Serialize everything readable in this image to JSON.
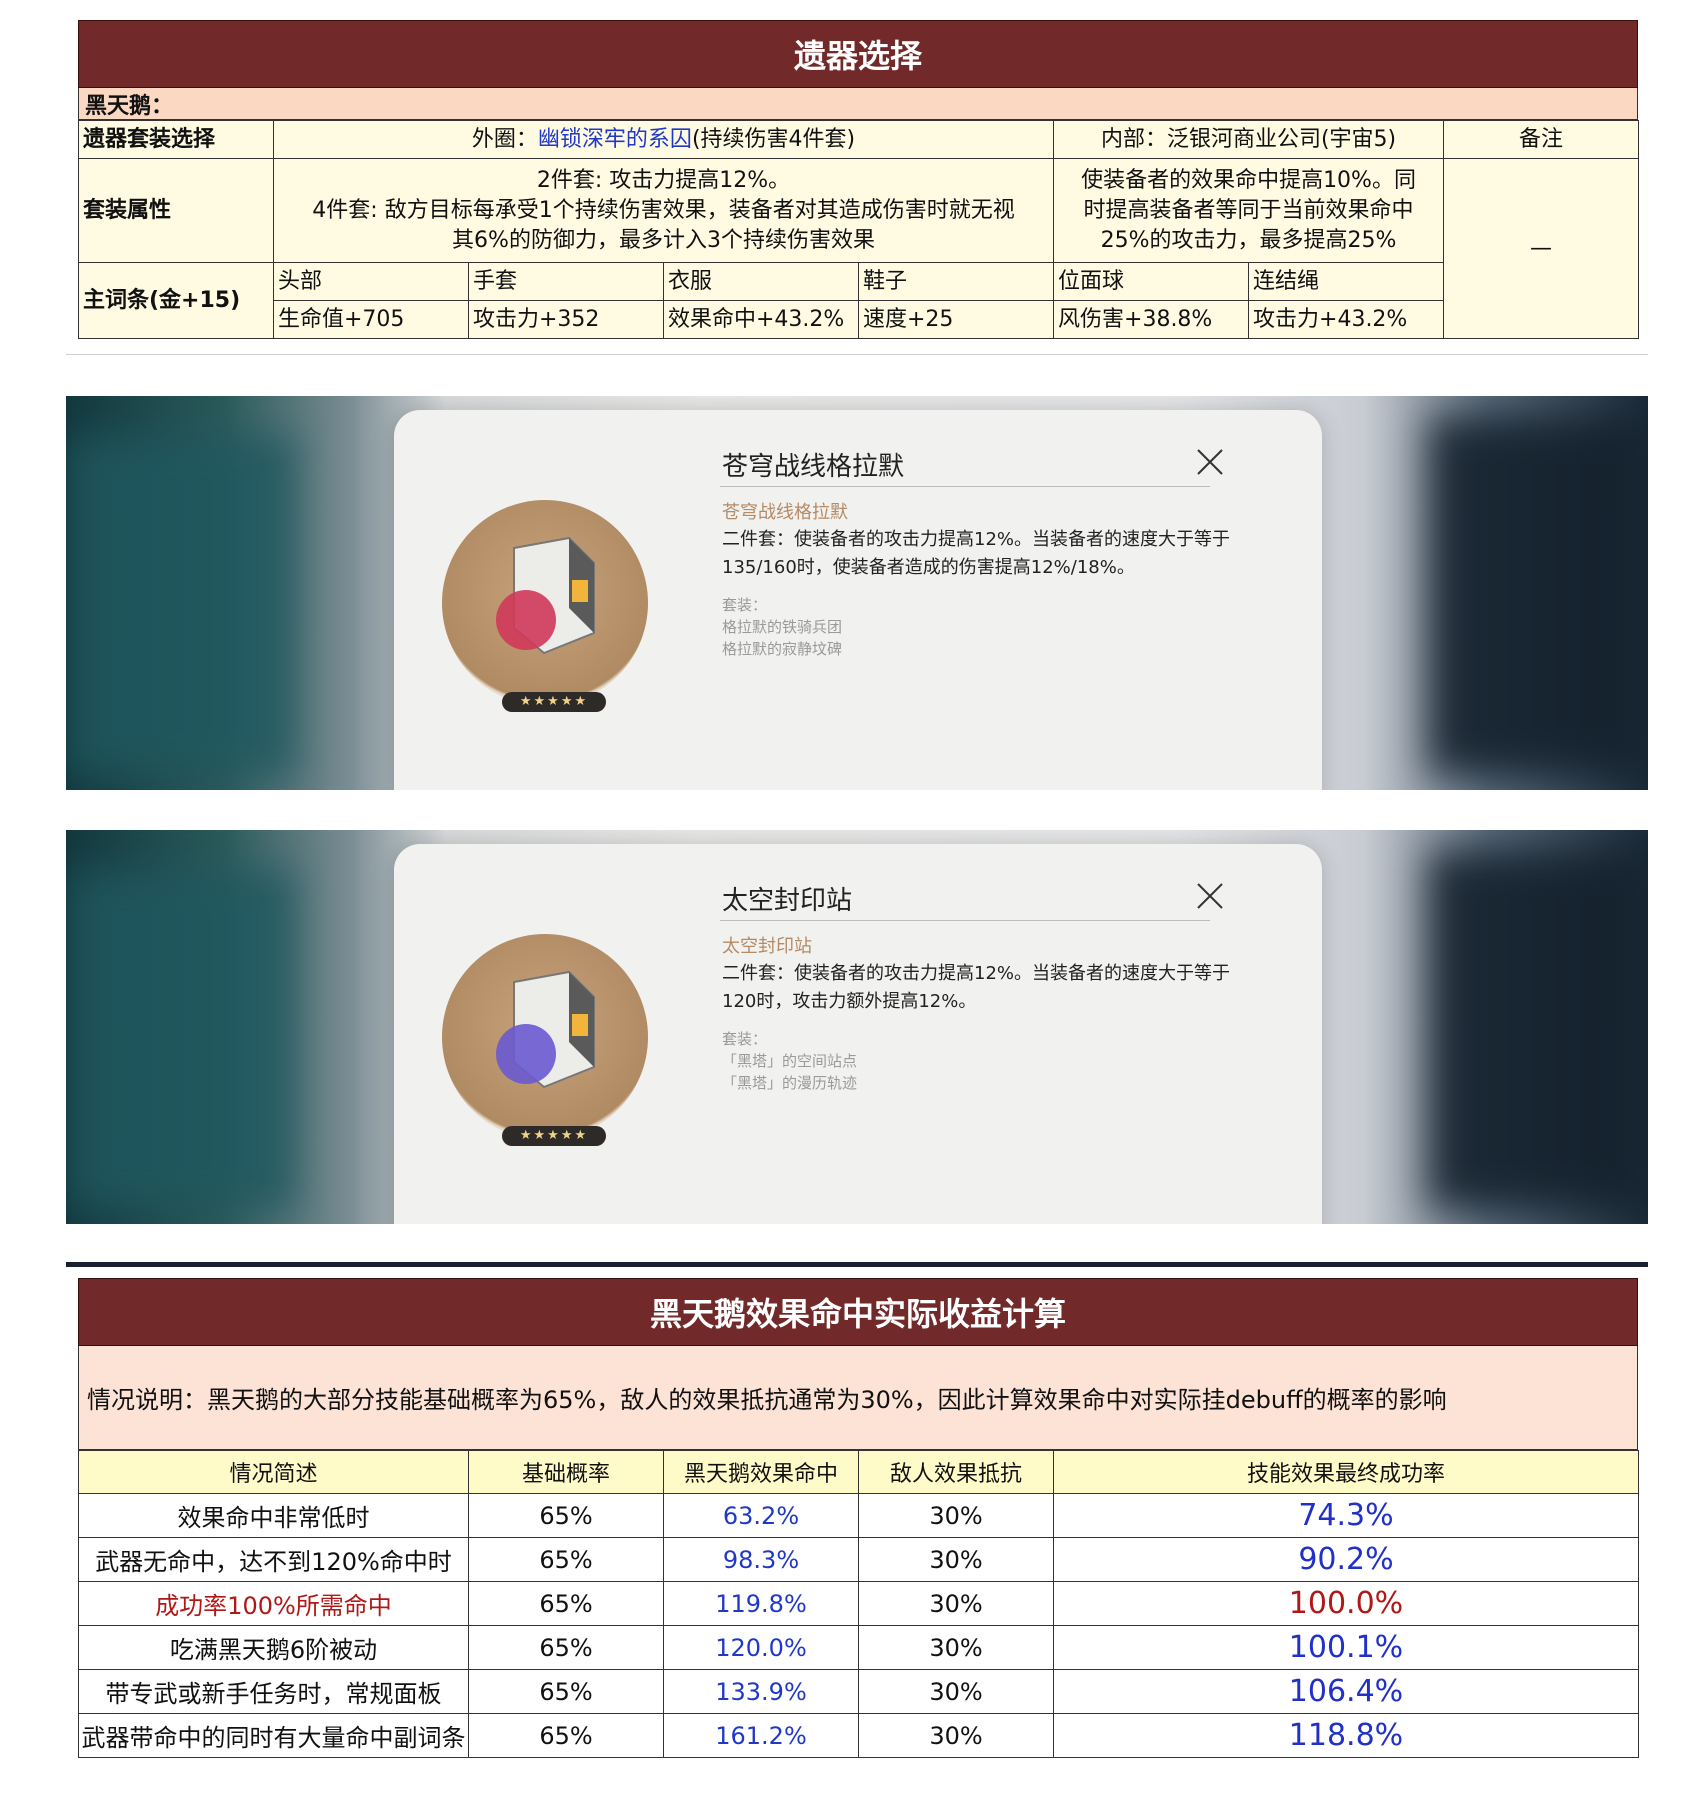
{
  "relic_table": {
    "title": "遗器选择",
    "character": "黑天鹅：",
    "row_set_label": "遗器套装选择",
    "outer_prefix": "外圈：",
    "outer_link": "幽锁深牢的系囚",
    "outer_suffix": "(持续伤害4件套)",
    "inner": "内部：泛银河商业公司(宇宙5)",
    "remarks_label": "备注",
    "remarks_value": "—",
    "attr_label": "套装属性",
    "outer_effect_line1": "2件套: 攻击力提高12%。",
    "outer_effect_line2": "4件套: 敌方目标每承受1个持续伤害效果，装备者对其造成伤害时就无视",
    "outer_effect_line3": "其6%的防御力，最多计入3个持续伤害效果",
    "inner_effect_line1": "使装备者的效果命中提高10%。同",
    "inner_effect_line2": "时提高装备者等同于当前效果命中",
    "inner_effect_line3": "25%的攻击力，最多提高25%",
    "main_stat_label": "主词条(金+15)",
    "slots": [
      {
        "name": "头部",
        "stat": "生命值+705"
      },
      {
        "name": "手套",
        "stat": "攻击力+352"
      },
      {
        "name": "衣服",
        "stat": "效果命中+43.2%"
      },
      {
        "name": "鞋子",
        "stat": "速度+25"
      },
      {
        "name": "位面球",
        "stat": "风伤害+38.8%"
      },
      {
        "name": "连结绳",
        "stat": "攻击力+43.2%"
      }
    ]
  },
  "cards": [
    {
      "title": "苍穹战线格拉默",
      "subtitle": "苍穹战线格拉默",
      "desc_line1": "二件套：使装备者的攻击力提高12%。当装备者的速度大于等于",
      "desc_line2": "135/160时，使装备者造成的伤害提高12%/18%。",
      "set_label": "套装：",
      "set_items": [
        "格拉默的铁骑兵团",
        "格拉默的寂静坟碑"
      ],
      "stars": "★★★★★",
      "gem_color": "#d0385a"
    },
    {
      "title": "太空封印站",
      "subtitle": "太空封印站",
      "desc_line1": "二件套：使装备者的攻击力提高12%。当装备者的速度大于等于",
      "desc_line2": "120时，攻击力额外提高12%。",
      "set_label": "套装：",
      "set_items": [
        "「黑塔」的空间站点",
        "「黑塔」的漫历轨迹"
      ],
      "stars": "★★★★★",
      "gem_color": "#6a5ad0"
    }
  ],
  "calc_table": {
    "title": "黑天鹅效果命中实际收益计算",
    "note": "情况说明：黑天鹅的大部分技能基础概率为65%，敌人的效果抵抗通常为30%，因此计算效果命中对实际挂debuff的概率的影响",
    "headers": [
      "情况简述",
      "基础概率",
      "黑天鹅效果命中",
      "敌人效果抵抗",
      "技能效果最终成功率"
    ],
    "rows": [
      {
        "desc": "效果命中非常低时",
        "base": "65%",
        "hit": "63.2%",
        "res": "30%",
        "final": "74.3%"
      },
      {
        "desc": "武器无命中，达不到120%命中时",
        "base": "65%",
        "hit": "98.3%",
        "res": "30%",
        "final": "90.2%"
      },
      {
        "desc": "成功率100%所需命中",
        "base": "65%",
        "hit": "119.8%",
        "res": "30%",
        "final": "100.0%"
      },
      {
        "desc": "吃满黑天鹅6阶被动",
        "base": "65%",
        "hit": "120.0%",
        "res": "30%",
        "final": "100.1%"
      },
      {
        "desc": "带专武或新手任务时，常规面板",
        "base": "65%",
        "hit": "133.9%",
        "res": "30%",
        "final": "106.4%"
      },
      {
        "desc": "武器带命中的同时有大量命中副词条",
        "base": "65%",
        "hit": "161.2%",
        "res": "30%",
        "final": "118.8%"
      }
    ]
  }
}
